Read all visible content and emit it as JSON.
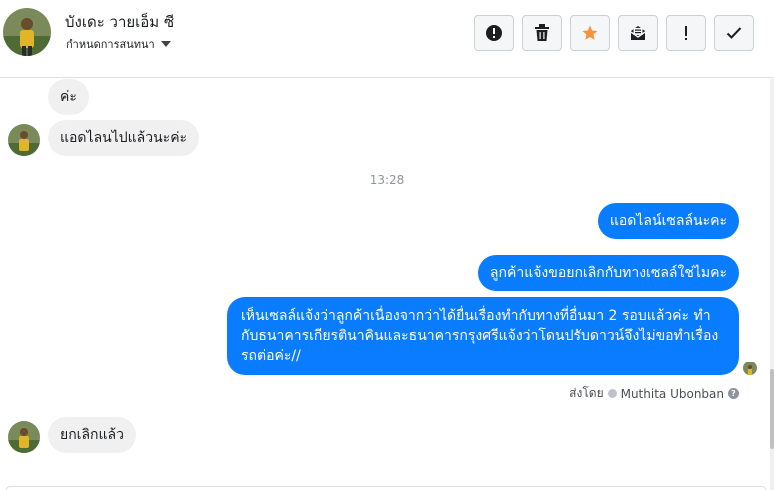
{
  "header": {
    "contact_name": "บังเดะ วายเอ็ม ซี",
    "assign_label": "กำหนดการสนทนา",
    "toolbar": [
      {
        "name": "mark-spam-button",
        "icon": "alert-circle-icon"
      },
      {
        "name": "delete-button",
        "icon": "trash-icon"
      },
      {
        "name": "star-button",
        "icon": "star-icon"
      },
      {
        "name": "mark-unread-button",
        "icon": "envelope-icon"
      },
      {
        "name": "follow-up-button",
        "icon": "exclamation-icon"
      },
      {
        "name": "mark-done-button",
        "icon": "checkmark-icon"
      }
    ]
  },
  "messages": [
    {
      "direction": "in",
      "text": "ค่ะ"
    },
    {
      "direction": "in",
      "text": "แอดไลนไปแล้วนะค่ะ"
    },
    {
      "type": "timestamp",
      "text": "13:28"
    },
    {
      "direction": "out",
      "text": "แอดไลน์เซลล์นะคะ"
    },
    {
      "direction": "out",
      "text": "ลูกค้าแจ้งขอยกเลิกกับทางเซลล์ใช่ไมคะ"
    },
    {
      "direction": "out",
      "text": "เห็นเซลล์แจ้งว่าลูกค้าเนื่องจากว่าได้ยื่นเรื่องทำกับทางที่อื่นมา 2 รอบแล้วค่ะ ทำกับธนาคารเกียรตินาคินและธนาคารกรุงศรีแจ้งว่าโดนปรับดาวน์จึงไม่ขอทำเรื่องรถต่อค่ะ//"
    },
    {
      "direction": "in",
      "text": "ยกเลิกแล้ว"
    }
  ],
  "sent_by": {
    "prefix": "ส่งโดย",
    "name": "Muthita Ubonban"
  },
  "colors": {
    "outgoing_bubble": "#0a7cff",
    "incoming_bubble": "#f1f0f0",
    "star": "#f7923b"
  }
}
